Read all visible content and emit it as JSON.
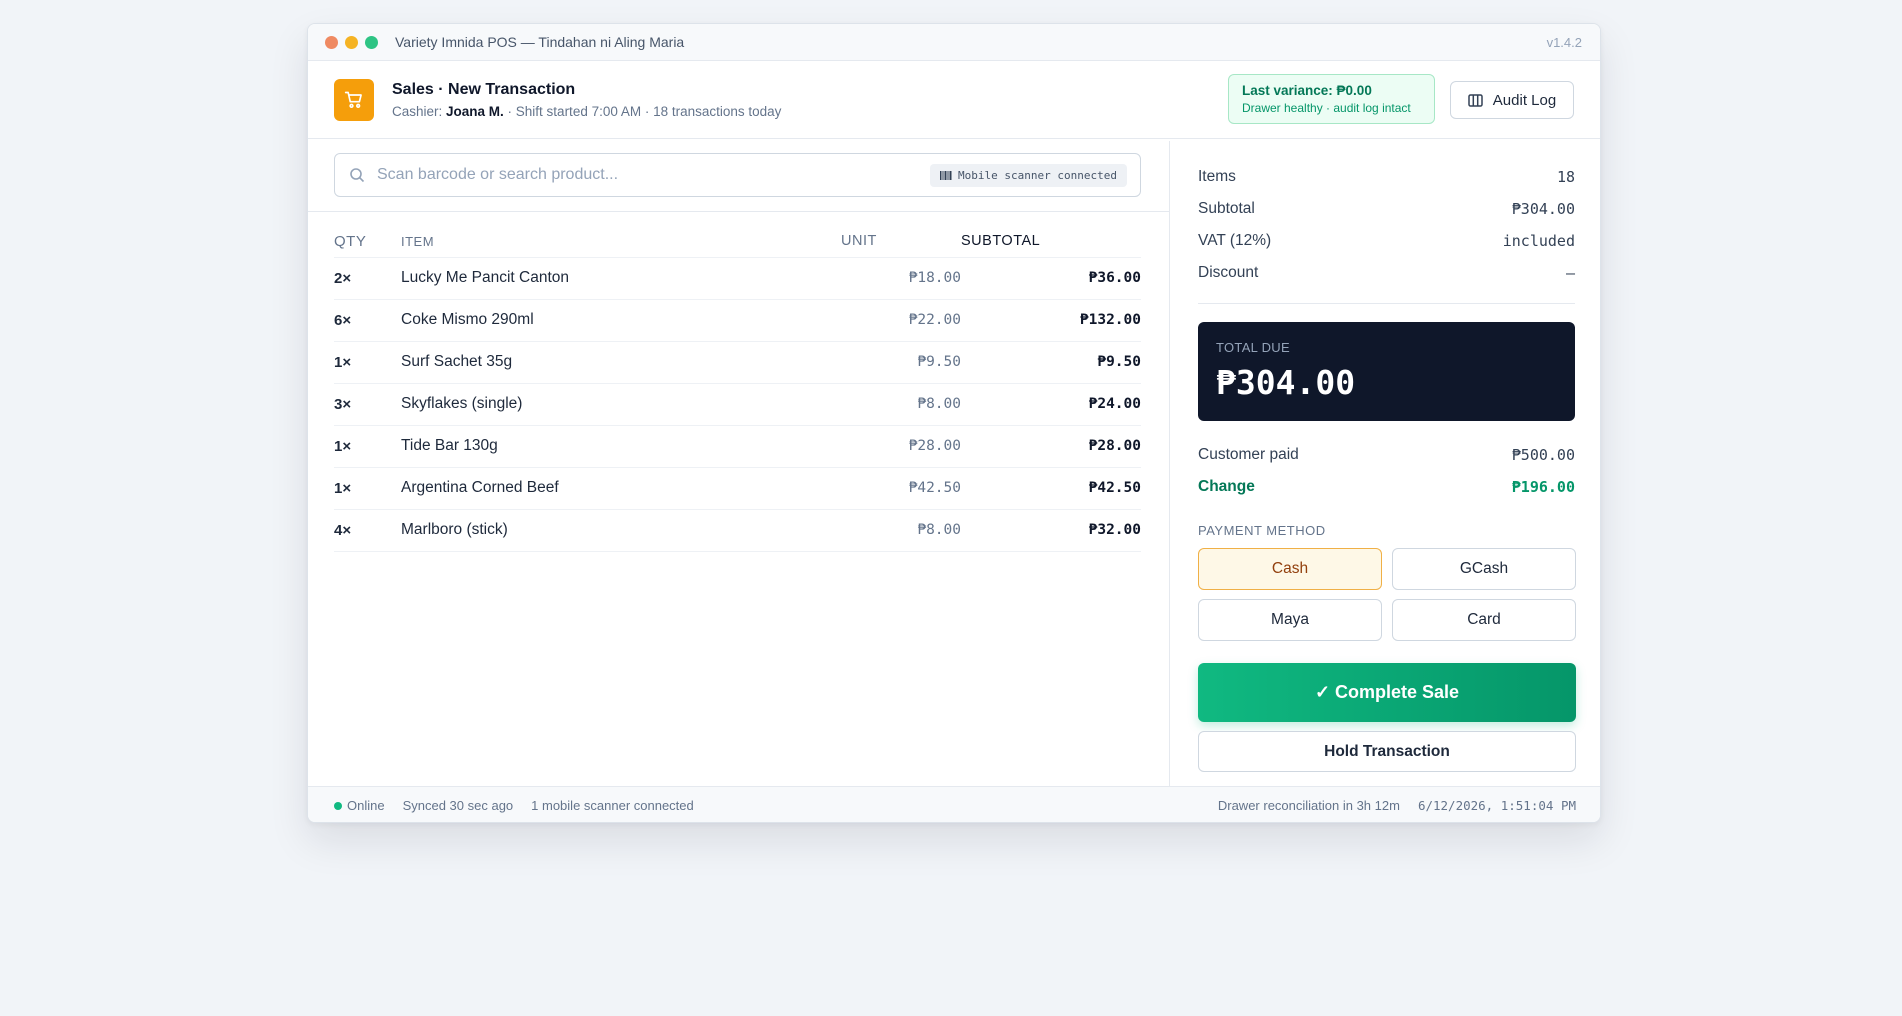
{
  "window": {
    "title": "Variety Imnida POS — Tindahan ni Aling Maria",
    "version": "v1.4.2",
    "dot_colors": [
      "#ef8a62",
      "#f5b323",
      "#2ec484"
    ]
  },
  "header": {
    "icon": "shopping-cart-icon",
    "title": "Sales · New Transaction",
    "cashier_prefix": "Cashier: ",
    "cashier_name": "Joana M.",
    "shift_info": " · Shift started 7:00 AM · 18 transactions today",
    "variance_main": "Last variance: ₱0.00",
    "variance_sub": "Drawer healthy · audit log intact",
    "audit_label": "Audit Log"
  },
  "search": {
    "placeholder": "Scan barcode or search product...",
    "scanner_badge": "Mobile scanner connected"
  },
  "table": {
    "headers": {
      "qty": "QTY",
      "item": "ITEM",
      "unit": "UNIT",
      "subtotal": "SUBTOTAL"
    },
    "rows": [
      {
        "qty": "2×",
        "item": "Lucky Me Pancit Canton",
        "unit": "₱18.00",
        "subtotal": "₱36.00"
      },
      {
        "qty": "6×",
        "item": "Coke Mismo 290ml",
        "unit": "₱22.00",
        "subtotal": "₱132.00"
      },
      {
        "qty": "1×",
        "item": "Surf Sachet 35g",
        "unit": "₱9.50",
        "subtotal": "₱9.50"
      },
      {
        "qty": "3×",
        "item": "Skyflakes (single)",
        "unit": "₱8.00",
        "subtotal": "₱24.00"
      },
      {
        "qty": "1×",
        "item": "Tide Bar 130g",
        "unit": "₱28.00",
        "subtotal": "₱28.00"
      },
      {
        "qty": "1×",
        "item": "Argentina Corned Beef",
        "unit": "₱42.50",
        "subtotal": "₱42.50"
      },
      {
        "qty": "4×",
        "item": "Marlboro (stick)",
        "unit": "₱8.00",
        "subtotal": "₱32.00"
      }
    ]
  },
  "summary": {
    "items_label": "Items",
    "items_value": "18",
    "subtotal_label": "Subtotal",
    "subtotal_value": "₱304.00",
    "vat_label": "VAT (12%)",
    "vat_value": "included",
    "discount_label": "Discount",
    "discount_value": "—",
    "total_label": "TOTAL DUE",
    "total_value": "₱304.00",
    "paid_label": "Customer paid",
    "paid_value": "₱500.00",
    "change_label": "Change",
    "change_value": "₱196.00"
  },
  "payment": {
    "label": "PAYMENT METHOD",
    "methods": [
      "Cash",
      "GCash",
      "Maya",
      "Card"
    ],
    "selected": "Cash"
  },
  "actions": {
    "complete_label": "✓ Complete Sale",
    "hold_label": "Hold Transaction"
  },
  "status": {
    "online": "Online",
    "synced": "Synced 30 sec ago",
    "scanner": "1 mobile scanner connected",
    "reconciliation": "Drawer reconciliation in 3h 12m",
    "datetime": "6/12/2026, 1:51:04 PM"
  },
  "colors": {
    "accent": "#f59e0b",
    "success": "#10b981",
    "total_bg": "#0f172a"
  }
}
